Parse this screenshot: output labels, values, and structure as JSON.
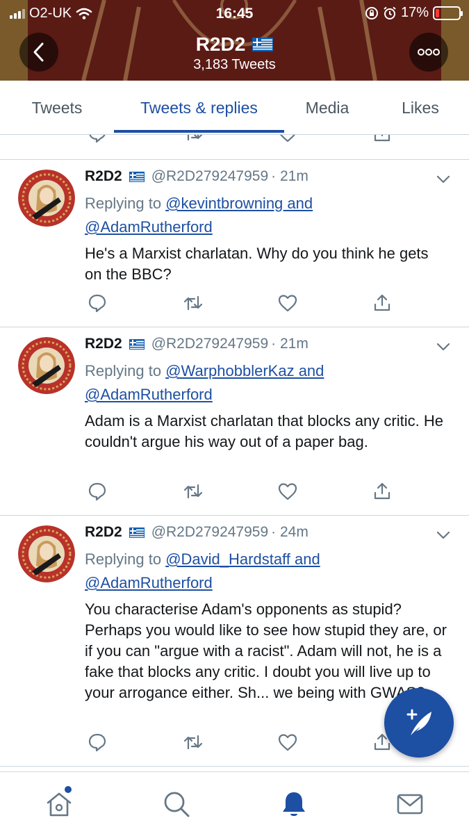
{
  "status_bar": {
    "carrier": "O2-UK",
    "time": "16:45",
    "battery": "17%",
    "battery_level": 0.17
  },
  "header": {
    "profile_name": "R2D2",
    "tweet_count": "3,183 Tweets",
    "back_icon": "chevron-left-icon",
    "more_icon": "more-icon"
  },
  "tabs": [
    {
      "label": "Tweets",
      "active": false
    },
    {
      "label": "Tweets & replies",
      "active": true
    },
    {
      "label": "Media",
      "active": false
    },
    {
      "label": "Likes",
      "active": false
    }
  ],
  "tweets": [
    {
      "name": "R2D2",
      "handle": "@R2D279247959",
      "time": "· 21m",
      "replying_prefix": "Replying to",
      "replying_line1": "@kevintbrowning and",
      "replying_line2": "@AdamRutherford",
      "text": "He's a Marxist charlatan. Why do you think he gets on the BBC?"
    },
    {
      "name": "R2D2",
      "handle": "@R2D279247959",
      "time": "· 21m",
      "replying_prefix": "Replying to",
      "replying_line1": "@WarphobblerKaz and",
      "replying_line2": "@AdamRutherford",
      "text": "Adam is a Marxist charlatan that blocks any critic. He couldn't argue his way out of a paper bag."
    },
    {
      "name": "R2D2",
      "handle": "@R2D279247959",
      "time": "· 24m",
      "replying_prefix": "Replying to",
      "replying_line1": "@David_Hardstaff and",
      "replying_line2": "@AdamRutherford",
      "text": "You characterise Adam's opponents as stupid? Perhaps you would like to see how stupid they are, or if you can \"argue with a racist\". Adam will not, he is a fake that blocks any critic. I doubt you will live up to your arrogance either. Sh... we being with GWAS?"
    }
  ],
  "colors": {
    "accent": "#1d4fa3",
    "secondary_text": "#657786",
    "divider": "#ccd6dd"
  },
  "bottom_nav": [
    "home-icon",
    "search-icon",
    "notifications-icon",
    "messages-icon"
  ]
}
